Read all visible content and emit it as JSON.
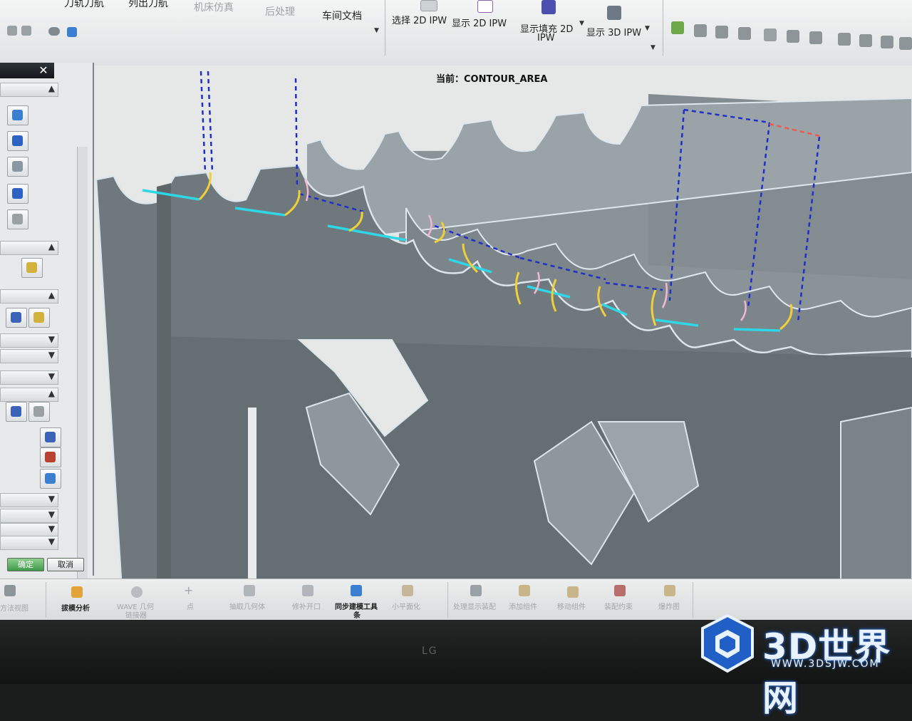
{
  "ribbon": {
    "partial_tabs": [
      "刀轨刀航",
      "列出刀航"
    ],
    "machine_sim": "机床仿真",
    "post_process": "后处理",
    "shop_docs": "车间文档",
    "select_2d_ipw": "选择 2D IPW",
    "show_2d_ipw": "显示 2D IPW",
    "show_fill_2d_ipw_l1": "显示填充 2D",
    "show_fill_2d_ipw_l2": "IPW",
    "show_3d_ipw": "显示 3D IPW"
  },
  "viewport": {
    "current_label": "当前：CONTOUR_AREA"
  },
  "dialog": {
    "close": "✕",
    "ok": "确定",
    "cancel": "取消"
  },
  "bottombar": {
    "items": [
      {
        "label": "方法视图"
      },
      {
        "label": "拔模分析"
      },
      {
        "label_l1": "WAVE 几何",
        "label_l2": "链接器"
      },
      {
        "label": "点"
      },
      {
        "label": "抽取几何体"
      },
      {
        "label": "修补开口"
      },
      {
        "label_l1": "同步建模工具",
        "label_l2": "条"
      },
      {
        "label": "小平面化"
      },
      {
        "label": "处理显示装配"
      },
      {
        "label": "添加组件"
      },
      {
        "label": "移动组件"
      },
      {
        "label": "装配约束"
      },
      {
        "label": "爆炸图"
      }
    ]
  },
  "bezel": {
    "brand": "LG"
  },
  "watermark": {
    "text": "3D世界网",
    "url": "WWW.3DSJW.COM"
  },
  "colors": {
    "part_face": "#6f787c",
    "part_light": "#9aa3a7",
    "edge_highlight": "#dbe6ea",
    "path_blue": "#1f2fc8",
    "path_cyan": "#2fd6e6",
    "path_yellow": "#f1cf3a",
    "path_red": "#f0584a",
    "ok_green": "#49a453"
  }
}
